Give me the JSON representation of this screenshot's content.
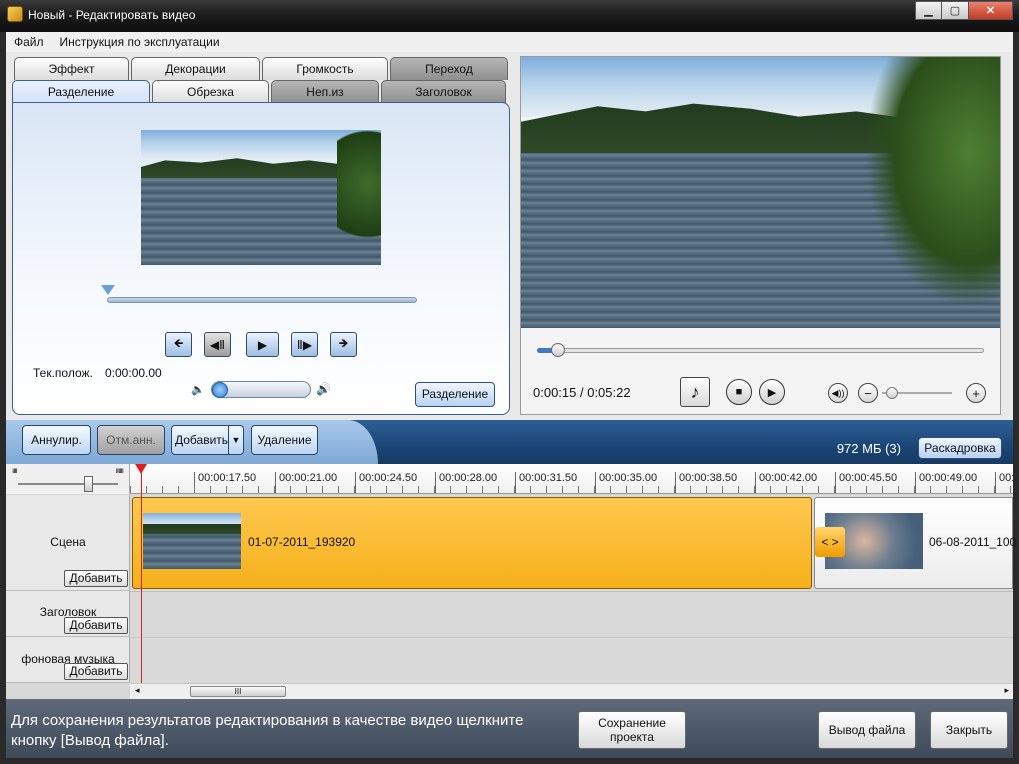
{
  "window": {
    "title": "Новый - Редактировать видео"
  },
  "menu": {
    "file": "Файл",
    "manual": "Инструкция по эксплуатации"
  },
  "tabs": {
    "row1": [
      "Эффект",
      "Декорации",
      "Громкость",
      "Переход"
    ],
    "row2": [
      "Разделение",
      "Обрезка",
      "Неп.из",
      "Заголовок"
    ],
    "active": "Разделение"
  },
  "split_panel": {
    "position_label": "Тек.полож.",
    "position_value": "0:00:00.00",
    "split_button": "Разделение"
  },
  "preview": {
    "time_current": "0:00:15",
    "time_separator": " / ",
    "time_total": "0:05:22",
    "progress_fraction": 0.04,
    "zoom_fraction": 0.0
  },
  "toolbar": {
    "undo": "Аннулир.",
    "redo": "Отм.анн.",
    "add": "Добавить",
    "delete": "Удаление",
    "storage": "972 МБ (3)",
    "storyboard": "Раскадровка"
  },
  "timeline": {
    "ticks": [
      "00:00:17.50",
      "00:00:21.00",
      "00:00:24.50",
      "00:00:28.00",
      "00:00:31.50",
      "00:00:35.00",
      "00:00:38.50",
      "00:00:42.00",
      "00:00:45.50",
      "00:00:49.00",
      "00:0"
    ],
    "rows": [
      {
        "name": "Сцена",
        "add": "Добавить"
      },
      {
        "name": "Заголовок",
        "add": "Добавить"
      },
      {
        "name": "фоновая музыка",
        "add": "Добавить"
      }
    ],
    "clips": [
      "01-07-2011_193920",
      "06-08-2011_100"
    ],
    "transition_label": "< >",
    "scroll_grip": "III"
  },
  "bottom": {
    "message": "Для сохранения результатов редактирования в качестве видео щелкните кнопку [Вывод файла].",
    "save_project_line1": "Сохранение",
    "save_project_line2": "проекта",
    "output": "Вывод файла",
    "close": "Закрыть"
  },
  "colors": {
    "accent": "#1b4677",
    "clip": "#f5b01a",
    "playhead": "#e02020"
  }
}
